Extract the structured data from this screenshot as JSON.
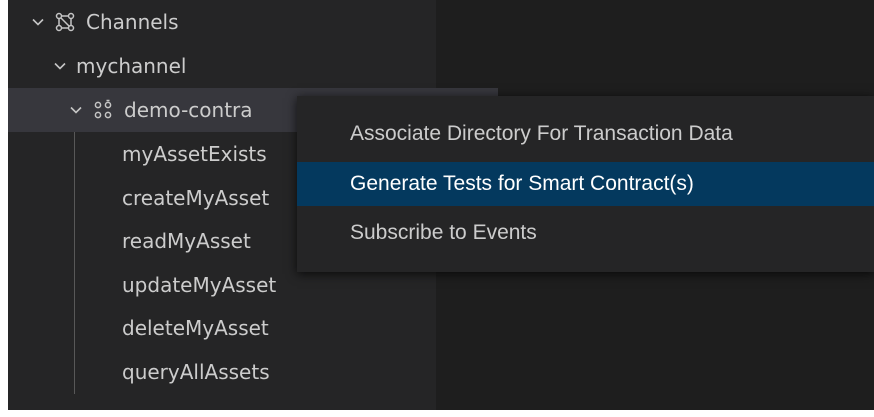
{
  "tree": {
    "channels": {
      "label": "Channels",
      "icon": "channels-network-icon",
      "chevron": "chevron-down-icon"
    },
    "channel": {
      "label": "mychannel",
      "chevron": "chevron-down-icon"
    },
    "contract": {
      "label": "demo-contra",
      "icon": "smart-contract-icon",
      "chevron": "chevron-down-icon"
    },
    "transactions": [
      "myAssetExists",
      "createMyAsset",
      "readMyAsset",
      "updateMyAsset",
      "deleteMyAsset",
      "queryAllAssets"
    ]
  },
  "context_menu": {
    "items": [
      "Associate Directory For Transaction Data",
      "Generate Tests for Smart Contract(s)",
      "Subscribe to Events"
    ],
    "highlighted_index": 1
  },
  "colors": {
    "sidebar_bg": "#252526",
    "editor_bg": "#1e1e1e",
    "selected_row": "#37373d",
    "menu_highlight": "#04395e",
    "text": "#cccccc"
  }
}
